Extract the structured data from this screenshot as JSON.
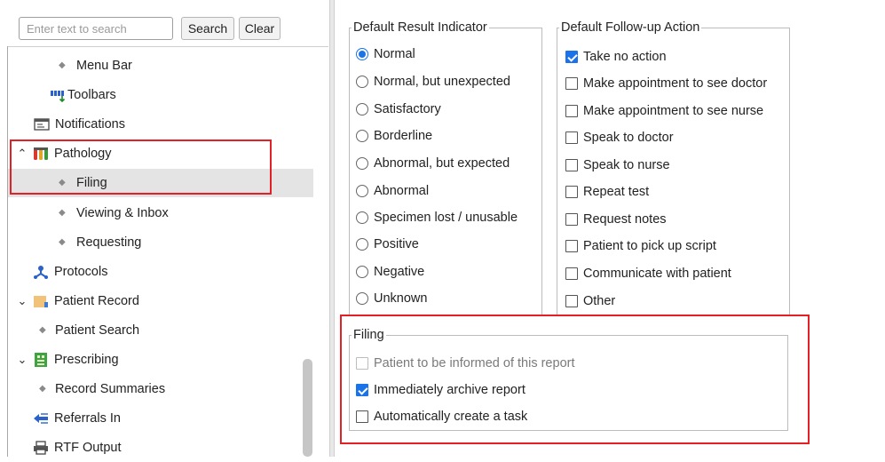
{
  "search": {
    "placeholder": "Enter text to search",
    "search_label": "Search",
    "clear_label": "Clear"
  },
  "tree": {
    "menu_bar": "Menu Bar",
    "toolbars": "Toolbars",
    "notifications": "Notifications",
    "pathology": "Pathology",
    "filing": "Filing",
    "viewing_inbox": "Viewing & Inbox",
    "requesting": "Requesting",
    "protocols": "Protocols",
    "patient_record": "Patient Record",
    "patient_search": "Patient Search",
    "prescribing": "Prescribing",
    "record_summaries": "Record Summaries",
    "referrals_in": "Referrals In",
    "rtf_output": "RTF Output"
  },
  "result_indicator": {
    "title": "Default Result Indicator",
    "options": [
      "Normal",
      "Normal, but unexpected",
      "Satisfactory",
      "Borderline",
      "Abnormal, but expected",
      "Abnormal",
      "Specimen lost / unusable",
      "Positive",
      "Negative",
      "Unknown"
    ],
    "selected": "Normal"
  },
  "followup": {
    "title": "Default Follow-up Action",
    "options": [
      "Take no action",
      "Make appointment to see doctor",
      "Make appointment to see nurse",
      "Speak to doctor",
      "Speak to nurse",
      "Repeat test",
      "Request notes",
      "Patient to pick up script",
      "Communicate with patient",
      "Other"
    ],
    "checked": [
      "Take no action"
    ]
  },
  "filing": {
    "title": "Filing",
    "patient_informed": "Patient to be informed of this report",
    "immediately_archive": "Immediately archive report",
    "auto_task": "Automatically create a task"
  },
  "colors": {
    "accent": "#1a73e8",
    "highlight": "#e32026",
    "selected_row": "#e4e4e4"
  }
}
